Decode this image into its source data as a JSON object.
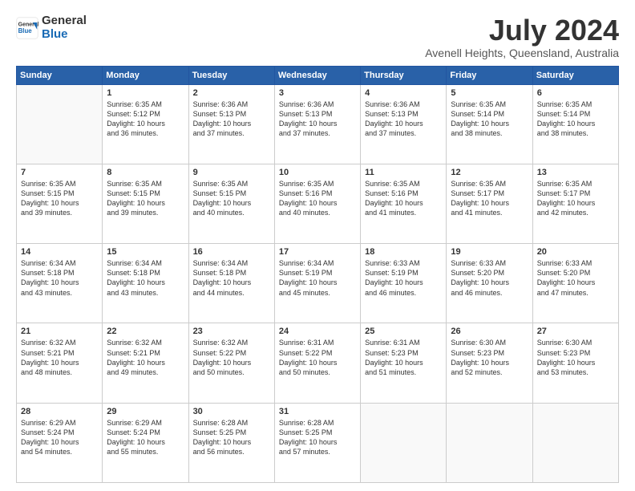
{
  "header": {
    "logo_general": "General",
    "logo_blue": "Blue",
    "month_year": "July 2024",
    "location": "Avenell Heights, Queensland, Australia"
  },
  "calendar": {
    "days_of_week": [
      "Sunday",
      "Monday",
      "Tuesday",
      "Wednesday",
      "Thursday",
      "Friday",
      "Saturday"
    ],
    "weeks": [
      [
        {
          "day": "",
          "info": ""
        },
        {
          "day": "1",
          "info": "Sunrise: 6:35 AM\nSunset: 5:12 PM\nDaylight: 10 hours\nand 36 minutes."
        },
        {
          "day": "2",
          "info": "Sunrise: 6:36 AM\nSunset: 5:13 PM\nDaylight: 10 hours\nand 37 minutes."
        },
        {
          "day": "3",
          "info": "Sunrise: 6:36 AM\nSunset: 5:13 PM\nDaylight: 10 hours\nand 37 minutes."
        },
        {
          "day": "4",
          "info": "Sunrise: 6:36 AM\nSunset: 5:13 PM\nDaylight: 10 hours\nand 37 minutes."
        },
        {
          "day": "5",
          "info": "Sunrise: 6:35 AM\nSunset: 5:14 PM\nDaylight: 10 hours\nand 38 minutes."
        },
        {
          "day": "6",
          "info": "Sunrise: 6:35 AM\nSunset: 5:14 PM\nDaylight: 10 hours\nand 38 minutes."
        }
      ],
      [
        {
          "day": "7",
          "info": "Sunrise: 6:35 AM\nSunset: 5:15 PM\nDaylight: 10 hours\nand 39 minutes."
        },
        {
          "day": "8",
          "info": "Sunrise: 6:35 AM\nSunset: 5:15 PM\nDaylight: 10 hours\nand 39 minutes."
        },
        {
          "day": "9",
          "info": "Sunrise: 6:35 AM\nSunset: 5:15 PM\nDaylight: 10 hours\nand 40 minutes."
        },
        {
          "day": "10",
          "info": "Sunrise: 6:35 AM\nSunset: 5:16 PM\nDaylight: 10 hours\nand 40 minutes."
        },
        {
          "day": "11",
          "info": "Sunrise: 6:35 AM\nSunset: 5:16 PM\nDaylight: 10 hours\nand 41 minutes."
        },
        {
          "day": "12",
          "info": "Sunrise: 6:35 AM\nSunset: 5:17 PM\nDaylight: 10 hours\nand 41 minutes."
        },
        {
          "day": "13",
          "info": "Sunrise: 6:35 AM\nSunset: 5:17 PM\nDaylight: 10 hours\nand 42 minutes."
        }
      ],
      [
        {
          "day": "14",
          "info": "Sunrise: 6:34 AM\nSunset: 5:18 PM\nDaylight: 10 hours\nand 43 minutes."
        },
        {
          "day": "15",
          "info": "Sunrise: 6:34 AM\nSunset: 5:18 PM\nDaylight: 10 hours\nand 43 minutes."
        },
        {
          "day": "16",
          "info": "Sunrise: 6:34 AM\nSunset: 5:18 PM\nDaylight: 10 hours\nand 44 minutes."
        },
        {
          "day": "17",
          "info": "Sunrise: 6:34 AM\nSunset: 5:19 PM\nDaylight: 10 hours\nand 45 minutes."
        },
        {
          "day": "18",
          "info": "Sunrise: 6:33 AM\nSunset: 5:19 PM\nDaylight: 10 hours\nand 46 minutes."
        },
        {
          "day": "19",
          "info": "Sunrise: 6:33 AM\nSunset: 5:20 PM\nDaylight: 10 hours\nand 46 minutes."
        },
        {
          "day": "20",
          "info": "Sunrise: 6:33 AM\nSunset: 5:20 PM\nDaylight: 10 hours\nand 47 minutes."
        }
      ],
      [
        {
          "day": "21",
          "info": "Sunrise: 6:32 AM\nSunset: 5:21 PM\nDaylight: 10 hours\nand 48 minutes."
        },
        {
          "day": "22",
          "info": "Sunrise: 6:32 AM\nSunset: 5:21 PM\nDaylight: 10 hours\nand 49 minutes."
        },
        {
          "day": "23",
          "info": "Sunrise: 6:32 AM\nSunset: 5:22 PM\nDaylight: 10 hours\nand 50 minutes."
        },
        {
          "day": "24",
          "info": "Sunrise: 6:31 AM\nSunset: 5:22 PM\nDaylight: 10 hours\nand 50 minutes."
        },
        {
          "day": "25",
          "info": "Sunrise: 6:31 AM\nSunset: 5:23 PM\nDaylight: 10 hours\nand 51 minutes."
        },
        {
          "day": "26",
          "info": "Sunrise: 6:30 AM\nSunset: 5:23 PM\nDaylight: 10 hours\nand 52 minutes."
        },
        {
          "day": "27",
          "info": "Sunrise: 6:30 AM\nSunset: 5:23 PM\nDaylight: 10 hours\nand 53 minutes."
        }
      ],
      [
        {
          "day": "28",
          "info": "Sunrise: 6:29 AM\nSunset: 5:24 PM\nDaylight: 10 hours\nand 54 minutes."
        },
        {
          "day": "29",
          "info": "Sunrise: 6:29 AM\nSunset: 5:24 PM\nDaylight: 10 hours\nand 55 minutes."
        },
        {
          "day": "30",
          "info": "Sunrise: 6:28 AM\nSunset: 5:25 PM\nDaylight: 10 hours\nand 56 minutes."
        },
        {
          "day": "31",
          "info": "Sunrise: 6:28 AM\nSunset: 5:25 PM\nDaylight: 10 hours\nand 57 minutes."
        },
        {
          "day": "",
          "info": ""
        },
        {
          "day": "",
          "info": ""
        },
        {
          "day": "",
          "info": ""
        }
      ]
    ]
  }
}
